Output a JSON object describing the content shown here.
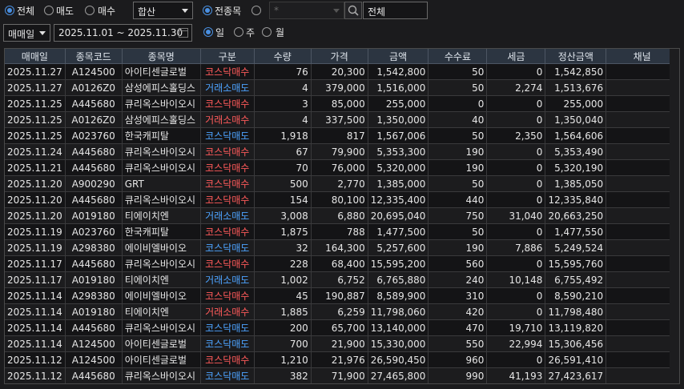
{
  "filters": {
    "trade_type": {
      "options": [
        "전체",
        "매도",
        "매수"
      ],
      "selected": 0
    },
    "account_select": "합산",
    "scope": {
      "all_label": "전종목",
      "selected": "all"
    },
    "symbol_input_placeholder": "*",
    "symbol_name": "전체",
    "date_type": "매매일",
    "date_range": "2025.11.01 ~ 2025.11.30",
    "period": {
      "options": [
        "일",
        "주",
        "월"
      ],
      "selected": 0
    }
  },
  "colors": {
    "buy": "#ff5a5a",
    "sell": "#4da3ff",
    "accent": "#4a90e2"
  },
  "table": {
    "columns": [
      "매매일",
      "종목코드",
      "종목명",
      "구분",
      "수량",
      "가격",
      "금액",
      "수수료",
      "세금",
      "정산금액",
      "채널"
    ],
    "rows": [
      [
        "2025.11.27",
        "A124500",
        "아이티센글로벌",
        "코스닥매수",
        "76",
        "20,300",
        "1,542,800",
        "50",
        "0",
        "1,542,850",
        ""
      ],
      [
        "2025.11.27",
        "A0126Z0",
        "삼성에피스홀딩스",
        "거래소매도",
        "4",
        "379,000",
        "1,516,000",
        "50",
        "2,274",
        "1,513,676",
        ""
      ],
      [
        "2025.11.25",
        "A445680",
        "큐리옥스바이오시",
        "코스닥매수",
        "3",
        "85,000",
        "255,000",
        "0",
        "0",
        "255,000",
        ""
      ],
      [
        "2025.11.25",
        "A0126Z0",
        "삼성에피스홀딩스",
        "거래소매수",
        "4",
        "337,500",
        "1,350,000",
        "40",
        "0",
        "1,350,040",
        ""
      ],
      [
        "2025.11.25",
        "A023760",
        "한국캐피탈",
        "코스닥매도",
        "1,918",
        "817",
        "1,567,006",
        "50",
        "2,350",
        "1,564,606",
        ""
      ],
      [
        "2025.11.24",
        "A445680",
        "큐리옥스바이오시",
        "코스닥매수",
        "67",
        "79,900",
        "5,353,300",
        "190",
        "0",
        "5,353,490",
        ""
      ],
      [
        "2025.11.21",
        "A445680",
        "큐리옥스바이오시",
        "코스닥매수",
        "70",
        "76,000",
        "5,320,000",
        "190",
        "0",
        "5,320,190",
        ""
      ],
      [
        "2025.11.20",
        "A900290",
        "GRT",
        "코스닥매수",
        "500",
        "2,770",
        "1,385,000",
        "50",
        "0",
        "1,385,050",
        ""
      ],
      [
        "2025.11.20",
        "A445680",
        "큐리옥스바이오시",
        "코스닥매수",
        "154",
        "80,100",
        "12,335,400",
        "440",
        "0",
        "12,335,840",
        ""
      ],
      [
        "2025.11.20",
        "A019180",
        "티에이치엔",
        "거래소매도",
        "3,008",
        "6,880",
        "20,695,040",
        "750",
        "31,040",
        "20,663,250",
        ""
      ],
      [
        "2025.11.19",
        "A023760",
        "한국캐피탈",
        "코스닥매수",
        "1,875",
        "788",
        "1,477,500",
        "50",
        "0",
        "1,477,550",
        ""
      ],
      [
        "2025.11.19",
        "A298380",
        "에이비엘바이오",
        "코스닥매도",
        "32",
        "164,300",
        "5,257,600",
        "190",
        "7,886",
        "5,249,524",
        ""
      ],
      [
        "2025.11.17",
        "A445680",
        "큐리옥스바이오시",
        "코스닥매수",
        "228",
        "68,400",
        "15,595,200",
        "560",
        "0",
        "15,595,760",
        ""
      ],
      [
        "2025.11.17",
        "A019180",
        "티에이치엔",
        "거래소매도",
        "1,002",
        "6,752",
        "6,765,880",
        "240",
        "10,148",
        "6,755,492",
        ""
      ],
      [
        "2025.11.14",
        "A298380",
        "에이비엘바이오",
        "코스닥매수",
        "45",
        "190,887",
        "8,589,900",
        "310",
        "0",
        "8,590,210",
        ""
      ],
      [
        "2025.11.14",
        "A019180",
        "티에이치엔",
        "거래소매수",
        "1,885",
        "6,259",
        "11,798,060",
        "420",
        "0",
        "11,798,480",
        ""
      ],
      [
        "2025.11.14",
        "A445680",
        "큐리옥스바이오시",
        "코스닥매도",
        "200",
        "65,700",
        "13,140,000",
        "470",
        "19,710",
        "13,119,820",
        ""
      ],
      [
        "2025.11.14",
        "A124500",
        "아이티센글로벌",
        "코스닥매도",
        "700",
        "21,900",
        "15,330,000",
        "550",
        "22,994",
        "15,306,456",
        ""
      ],
      [
        "2025.11.12",
        "A124500",
        "아이티센글로벌",
        "코스닥매수",
        "1,210",
        "21,976",
        "26,590,450",
        "960",
        "0",
        "26,591,410",
        ""
      ],
      [
        "2025.11.12",
        "A445680",
        "큐리옥스바이오시",
        "코스닥매도",
        "382",
        "71,900",
        "27,465,800",
        "990",
        "41,193",
        "27,423,617",
        ""
      ]
    ]
  }
}
